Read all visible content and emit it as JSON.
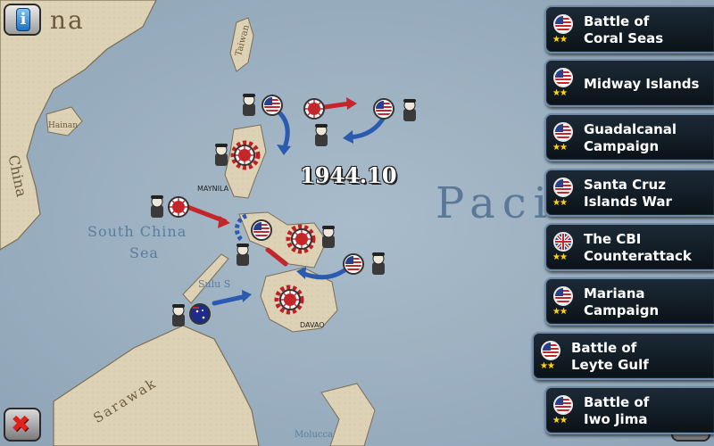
{
  "map": {
    "date": "1944.10",
    "ocean_label": "Paci",
    "sea_label_line1": "South China",
    "sea_label_line2": "Sea",
    "china_top": "na",
    "china_side": "China",
    "taiwan": "Taiwan",
    "hainan": "Hainan",
    "manila": "MAYNILA",
    "davao": "DAVAO",
    "sarawak": "Sarawak",
    "sulu": "Sulu S",
    "molucca": "Molucca"
  },
  "colors": {
    "us_arrow": "#2a5bb0",
    "jp_arrow": "#c4262a",
    "gear": "#c01e22",
    "campaign_border": "#6f8aa6",
    "star": "#ffd21a"
  },
  "campaigns": [
    {
      "label": "Battle of\nCoral Seas",
      "flag": "usa-flag-icon",
      "stars": "★★"
    },
    {
      "label": "Midway Islands",
      "flag": "usa-flag-icon",
      "stars": "★★"
    },
    {
      "label": "Guadalcanal\nCampaign",
      "flag": "usa-flag-icon",
      "stars": "★★"
    },
    {
      "label": "Santa Cruz\nIslands War",
      "flag": "usa-flag-icon",
      "stars": "★★"
    },
    {
      "label": "The CBI\nCounterattack",
      "flag": "uk-flag-icon",
      "stars": "★★"
    },
    {
      "label": "Mariana\nCampaign",
      "flag": "usa-flag-icon",
      "stars": "★★"
    },
    {
      "label": "Battle of\nLeyte Gulf",
      "flag": "usa-flag-icon",
      "stars": "★★"
    },
    {
      "label": "Battle of\nIwo Jima",
      "flag": "usa-flag-icon",
      "stars": "★★"
    }
  ],
  "buttons": {
    "info": "i",
    "close": "✖",
    "confirm": "✔"
  }
}
